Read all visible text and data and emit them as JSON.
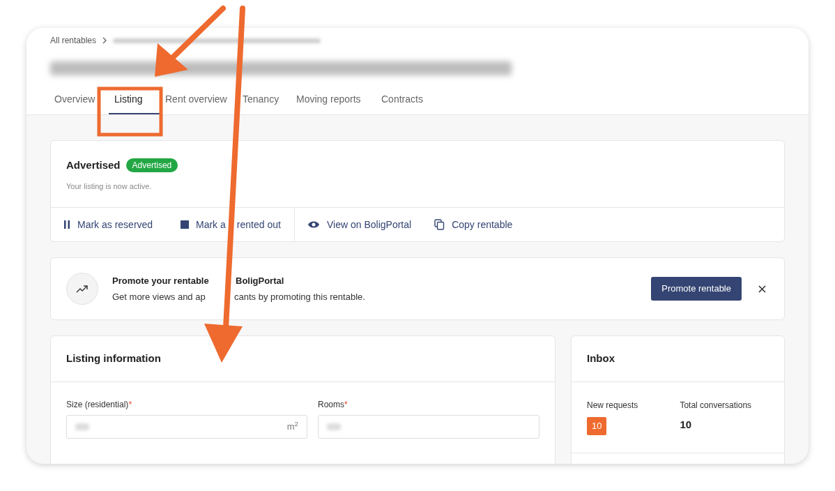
{
  "breadcrumb": {
    "root": "All rentables"
  },
  "tabs": [
    {
      "label": "Overview",
      "selected": false
    },
    {
      "label": "Listing",
      "selected": true
    },
    {
      "label": "Rent overview",
      "selected": false
    },
    {
      "label": "Tenancy",
      "selected": false
    },
    {
      "label": "Moving reports",
      "selected": false
    },
    {
      "label": "Contracts",
      "selected": false
    }
  ],
  "status_card": {
    "heading": "Advertised",
    "badge": "Advertised",
    "note": "Your listing is now active.",
    "actions": [
      {
        "kind": "pause",
        "label": "Mark as reserved"
      },
      {
        "kind": "stop",
        "label": "Mark a",
        "label_after": "rented out"
      },
      {
        "kind": "eye",
        "label": "View on BoligPortal"
      },
      {
        "kind": "copy",
        "label": "Copy rentable"
      }
    ]
  },
  "promo": {
    "heading": "Promote your rentable",
    "heading_after": "BoligPortal",
    "text": "Get more views and ap",
    "text_after": "cants by promoting this rentable.",
    "button": "Promote rentable"
  },
  "listing_info": {
    "heading": "Listing information",
    "fields": [
      {
        "label": "Size (residential)",
        "required_mark": "*",
        "unit": "m$^{2}$"
      },
      {
        "label": "Rooms",
        "required_mark": "*"
      }
    ]
  },
  "inbox": {
    "heading": "Inbox",
    "stats": [
      {
        "label": "New requests",
        "value": "10",
        "kind": "badge"
      },
      {
        "label": "Total conversations",
        "value": "10",
        "kind": "plain"
      }
    ]
  },
  "annotations": [
    {
      "kind": "arrow"
    },
    {
      "kind": "arrow"
    },
    {
      "kind": "frame"
    }
  ]
}
